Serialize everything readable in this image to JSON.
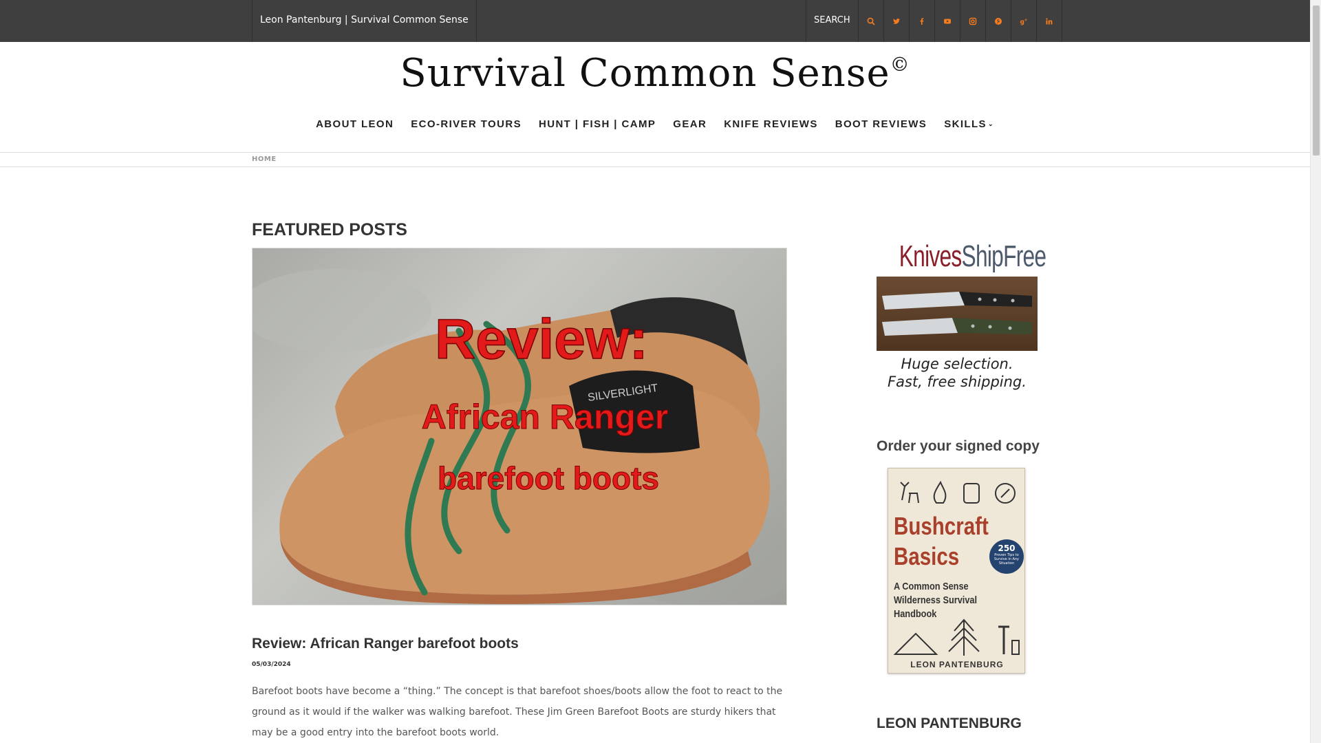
{
  "topbar": {
    "site_link": "Leon Pantenburg | Survival Common Sense",
    "search_label": "SEARCH",
    "icons": [
      "search-icon",
      "twitter-icon",
      "facebook-icon",
      "youtube-icon",
      "instagram-icon",
      "pinterest-icon",
      "google-plus-icon",
      "linkedin-icon"
    ],
    "icon_color": "#f57c1f",
    "background": "#3f3f3f"
  },
  "header": {
    "brand": "Survival Common Sense",
    "copyright_mark": "©"
  },
  "nav": {
    "items": [
      {
        "label": "ABOUT LEON"
      },
      {
        "label": "ECO-RIVER TOURS"
      },
      {
        "label": "HUNT | FISH | CAMP"
      },
      {
        "label": "GEAR"
      },
      {
        "label": "KNIFE REVIEWS"
      },
      {
        "label": "BOOT REVIEWS"
      },
      {
        "label": "SKILLS"
      }
    ]
  },
  "breadcrumb": {
    "home": "HOME"
  },
  "main": {
    "section_title": "FEATURED POSTS",
    "featured_image": {
      "line1": "Review:",
      "line2": "African Ranger",
      "line3": "barefoot boots",
      "sock_text": "SILVERLIGHT"
    },
    "post": {
      "title": "Review: African Ranger barefoot boots",
      "date": "05/03/2024",
      "excerpt": "Barefoot boots have become a “thing.” The concept is that barefoot shoes/boots allow the foot to react to the ground as it would if the walker was walking barefoot. These Jim Green Barefoot Boots are sturdy hikers that may be a good entry into the barefoot boots world."
    }
  },
  "sidebar": {
    "ad": {
      "logo_knives": "Knives",
      "logo_ship": "Ship",
      "logo_free": "Free",
      "caption_line1": "Huge selection.",
      "caption_line2": "Fast, free shipping."
    },
    "book_heading": "Order your signed copy",
    "book": {
      "title_line1": "Bushcraft",
      "title_line2": "Basics",
      "badge_number": "250",
      "badge_text": "Proven Tips to Survive in Any Situation",
      "subtitle_line1": "A Common Sense",
      "subtitle_line2": "Wilderness Survival",
      "subtitle_line3": "Handbook",
      "author": "LEON PANTENBURG"
    },
    "author_heading": "LEON PANTENBURG"
  }
}
